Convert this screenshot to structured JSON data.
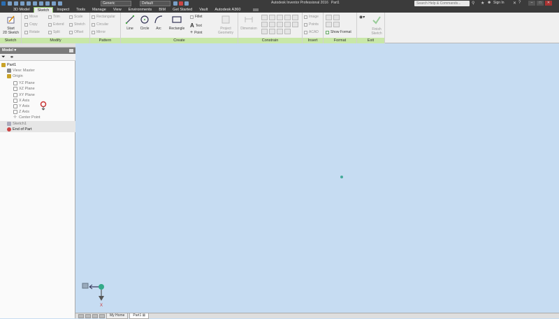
{
  "titlebar": {
    "title": "Autodesk Inventor Professional 2016",
    "document": "Part1",
    "material_combo": "Generic",
    "appearance_combo": "Default",
    "search_placeholder": "Search Help & Commands...",
    "sign_in": "Sign In"
  },
  "tabs": [
    "3D Model",
    "Sketch",
    "Inspect",
    "Tools",
    "Manage",
    "View",
    "Environments",
    "BIM",
    "Get Started",
    "Vault",
    "Autodesk A360"
  ],
  "ribbon": {
    "sketch": {
      "label": "Sketch",
      "start": "Start",
      "start2": "2D Sketch"
    },
    "modify": {
      "label": "Modify",
      "move": "Move",
      "trim": "Trim",
      "scale": "Scale",
      "copy": "Copy",
      "extend": "Extend",
      "stretch": "Stretch",
      "rotate": "Rotate",
      "split": "Split",
      "offset": "Offset"
    },
    "pattern": {
      "label": "Pattern",
      "rectangular": "Rectangular",
      "circular": "Circular",
      "mirror": "Mirror"
    },
    "create": {
      "label": "Create",
      "line": "Line",
      "circle": "Circle",
      "arc": "Arc",
      "rectangle": "Rectangle",
      "fillet": "Fillet",
      "text": "Text",
      "point": "Point",
      "project": "Project",
      "project2": "Geometry"
    },
    "constrain": {
      "label": "Constrain",
      "dimension": "Dimension"
    },
    "insert": {
      "label": "Insert",
      "image": "Image",
      "points": "Points",
      "acad": "ACAD"
    },
    "format": {
      "label": "Format",
      "show_format": "Show Format"
    },
    "exit": {
      "label": "Exit",
      "finish": "Finish",
      "finish2": "Sketch"
    }
  },
  "browser": {
    "title": "Model",
    "tree": [
      "Part1",
      "View: Master",
      "Origin",
      "YZ Plane",
      "XZ Plane",
      "XY Plane",
      "X Axis",
      "Y Axis",
      "Z Axis",
      "Center Point",
      "Sketch1",
      "End of Part"
    ]
  },
  "doctabs": {
    "home": "My Home",
    "part": "Part1"
  },
  "colors": {
    "accent_green": "#86c55b",
    "viewport": "#c6dcf2",
    "titlebar": "#3b3b3b"
  }
}
